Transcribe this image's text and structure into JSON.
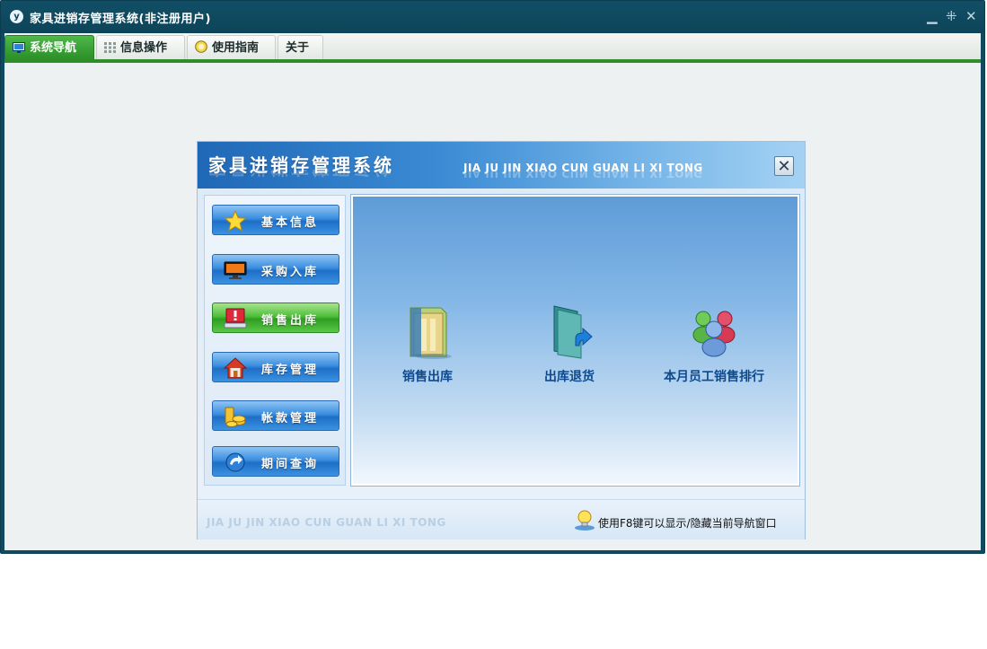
{
  "window": {
    "title": "家具进销存管理系统(非注册用户)",
    "app_icon_glyph": "y",
    "minimize_glyph": "▁",
    "restore_glyph": "⁜",
    "close_glyph": "✕"
  },
  "menu": {
    "tabs": [
      {
        "label": "系统导航",
        "icon": "monitor-icon",
        "active": true
      },
      {
        "label": "信息操作",
        "icon": "grid-icon",
        "active": false
      },
      {
        "label": "使用指南",
        "icon": "help-icon",
        "active": false
      },
      {
        "label": "关于",
        "icon": null,
        "active": false
      }
    ]
  },
  "dialog": {
    "title": "家具进销存管理系统",
    "subtitle": "JIA JU JIN XIAO CUN  GUAN LI XI TONG",
    "close_glyph": "✕",
    "sidebar": [
      {
        "label": "基本信息",
        "icon": "star-icon",
        "active": false
      },
      {
        "label": "采购入库",
        "icon": "monitor-icon",
        "active": false
      },
      {
        "label": "销售出库",
        "icon": "alert-computer-icon",
        "active": true
      },
      {
        "label": "库存管理",
        "icon": "house-icon",
        "active": false
      },
      {
        "label": "帐款管理",
        "icon": "coins-icon",
        "active": false
      },
      {
        "label": "期间查询",
        "icon": "refresh-arrow-icon",
        "active": false
      }
    ],
    "features": [
      {
        "label": "销售出库",
        "icon": "folder-binder-icon"
      },
      {
        "label": "出库退货",
        "icon": "folder-return-icon"
      },
      {
        "label": "本月员工销售排行",
        "icon": "users-group-icon"
      }
    ],
    "footer": {
      "watermark": "JIA JU JIN XIAO CUN GUAN LI XI TONG",
      "tip": "使用F8键可以显示/隐藏当前导航窗口"
    }
  },
  "colors": {
    "titlebar": "#0e4a60",
    "menu_accent": "#2f8d2a",
    "dialog_header": "#1f68b7",
    "sidebar_button": "#1d6fc6",
    "sidebar_button_active": "#2f9d22",
    "feature_label": "#0d4a8f"
  }
}
